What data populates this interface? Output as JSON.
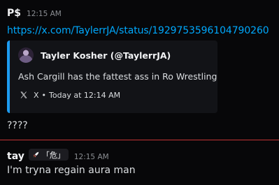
{
  "messages": [
    {
      "author": "P$",
      "timestamp": "12:15 AM",
      "link": "https://x.com/TaylerrJA/status/1929753596104790260",
      "embed": {
        "author_name": "Tayler Kosher (@TaylerrJA)",
        "description": "Ash Cargill has the fattest ass in Ro Wrestling",
        "footer_provider": "X",
        "footer_separator": "•",
        "footer_time": "Today at 12:14 AM",
        "accent_color": "#1d9bf0"
      },
      "text": "????"
    },
    {
      "author": "tay",
      "role_badge": "「危」",
      "timestamp": "12:15 AM",
      "text": "I'm tryna regain aura man"
    }
  ],
  "colors": {
    "background": "#070709",
    "link": "#00a8fc",
    "divider": "#c33434"
  },
  "icons": {
    "embed_avatar": "avatar",
    "provider": "x-logo-icon",
    "badge": "rocket-icon"
  }
}
